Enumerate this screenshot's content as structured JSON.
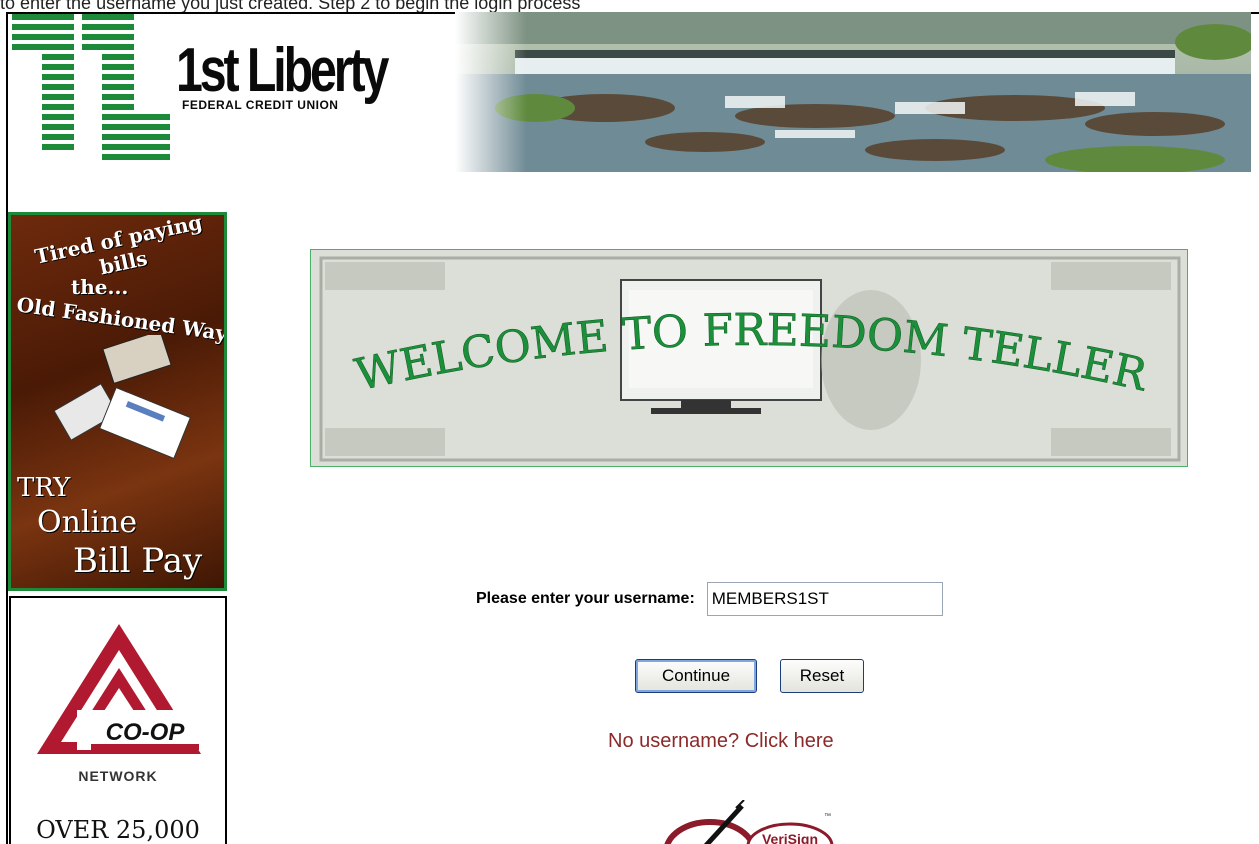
{
  "overlay": {
    "snippet": "to enter the username you just created. Step 2 to begin the login process"
  },
  "header": {
    "logo_name": "1st Liberty",
    "logo_tagline": "FEDERAL CREDIT UNION",
    "logo_icon": "stacked-green-bars-logo",
    "photo": "waterfall-dam-photo"
  },
  "ads": {
    "billpay": {
      "line1": "Tired of paying bills",
      "line2": "the...",
      "line3": "Old Fashioned Way",
      "try": "TRY",
      "online": "Online",
      "billpay": "Bill Pay"
    },
    "coop": {
      "logo_text": "CO-OP",
      "network": "NETWORK",
      "over": "OVER 25,000"
    }
  },
  "banner": {
    "title": "WELCOME TO FREEDOM TELLER"
  },
  "login": {
    "label": "Please enter your username:",
    "username_value": "MEMBERS1ST",
    "continue_label": "Continue",
    "reset_label": "Reset",
    "no_username_link": "No username? Click here"
  },
  "badge": {
    "text": "VeriSign"
  },
  "colors": {
    "brand_green": "#1d8a3a",
    "link_red": "#8b2a2a",
    "coop_red": "#b0192f"
  }
}
